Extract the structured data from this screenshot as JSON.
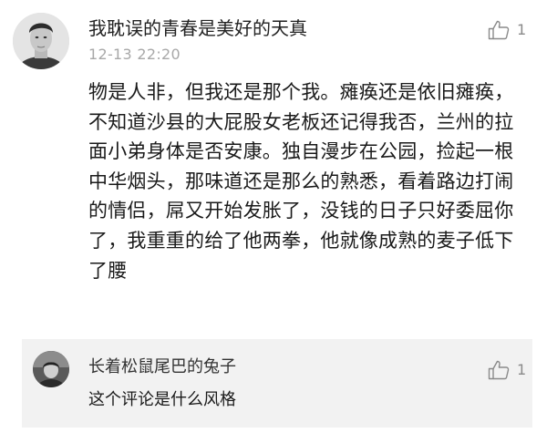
{
  "comment": {
    "avatar_icon": "user-portrait-icon",
    "username": "我耽误的青春是美好的天真",
    "timestamp": "12-13 22:20",
    "like_icon": "thumbs-up-icon",
    "like_count": "1",
    "body": "物是人非，但我还是那个我。瘫痪还是依旧瘫痪，不知道沙县的大屁股女老板还记得我否，兰州的拉面小弟身体是否安康。独自漫步在公园，捡起一根中华烟头，那味道还是那么的熟悉，看着路边打闹的情侣，屌又开始发胀了，没钱的日子只好委屈你了，我重重的给了他两拳，他就像成熟的麦子低下了腰"
  },
  "reply": {
    "avatar_icon": "user-portrait-icon",
    "username": "长着松鼠尾巴的兔子",
    "like_icon": "thumbs-up-icon",
    "like_count": "1",
    "text": "这个评论是什么风格"
  },
  "colors": {
    "username": "#222222",
    "timestamp": "#a8a8a8",
    "reply_background": "#f2f2f2",
    "icon_gray": "#8a8a8a"
  }
}
